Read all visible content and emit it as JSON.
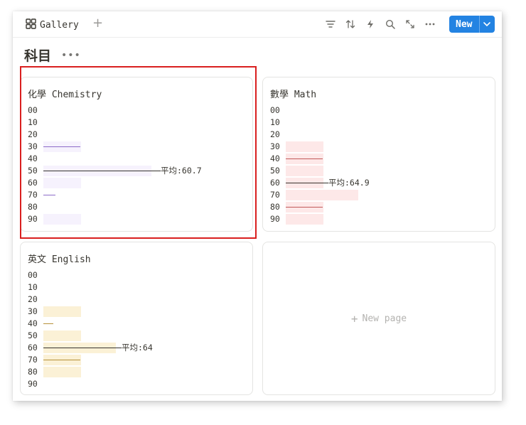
{
  "toolbar": {
    "view_label": "Gallery",
    "add_view_icon": "plus-icon",
    "icons": [
      "filter-icon",
      "sort-icon",
      "lightning-icon",
      "search-icon",
      "expand-icon",
      "more-icon"
    ],
    "new_button_label": "New"
  },
  "page": {
    "title": "科目"
  },
  "scale_labels": [
    "00",
    "10",
    "20",
    "30",
    "40",
    "50",
    "60",
    "70",
    "80",
    "90"
  ],
  "cards": [
    {
      "title": "化學 Chemistry",
      "color": "#8d6cc9",
      "fill": "#f6f2fd",
      "avg_label": "平均:60.7",
      "avg_row": 5,
      "rows": [
        {
          "bar": 0,
          "line": 0
        },
        {
          "bar": 0,
          "line": 0
        },
        {
          "bar": 0,
          "line": 0
        },
        {
          "bar": 1,
          "line": 1
        },
        {
          "bar": 0,
          "line": 0
        },
        {
          "bar": 3,
          "line": 0
        },
        {
          "bar": 1,
          "line": 0
        },
        {
          "bar": 0,
          "line": 0.3
        },
        {
          "bar": 0,
          "line": 0
        },
        {
          "bar": 1,
          "line": 0
        }
      ],
      "avg_line": 3.3
    },
    {
      "title": "數學 Math",
      "color": "#c25a5a",
      "fill": "#fde8e8",
      "avg_label": "平均:64.9",
      "avg_row": 6,
      "rows": [
        {
          "bar": 0,
          "line": 0
        },
        {
          "bar": 0,
          "line": 0
        },
        {
          "bar": 0,
          "line": 0
        },
        {
          "bar": 1,
          "line": 0
        },
        {
          "bar": 1,
          "line": 1
        },
        {
          "bar": 1,
          "line": 0
        },
        {
          "bar": 1,
          "line": 0
        },
        {
          "bar": 2,
          "line": 0
        },
        {
          "bar": 1,
          "line": 1
        },
        {
          "bar": 1,
          "line": 0
        }
      ],
      "avg_line": 1.2
    },
    {
      "title": "英文 English",
      "color": "#b6913a",
      "fill": "#fbf1d6",
      "avg_label": "平均:64",
      "avg_row": 6,
      "rows": [
        {
          "bar": 0,
          "line": 0
        },
        {
          "bar": 0,
          "line": 0
        },
        {
          "bar": 0,
          "line": 0
        },
        {
          "bar": 1,
          "line": 0
        },
        {
          "bar": 0,
          "line": 0.2
        },
        {
          "bar": 1,
          "line": 0
        },
        {
          "bar": 2,
          "line": 0
        },
        {
          "bar": 1,
          "line": 1
        },
        {
          "bar": 1,
          "line": 0
        },
        {
          "bar": 0,
          "line": 0
        }
      ],
      "avg_line": 2.2
    }
  ],
  "new_page_label": "New page"
}
